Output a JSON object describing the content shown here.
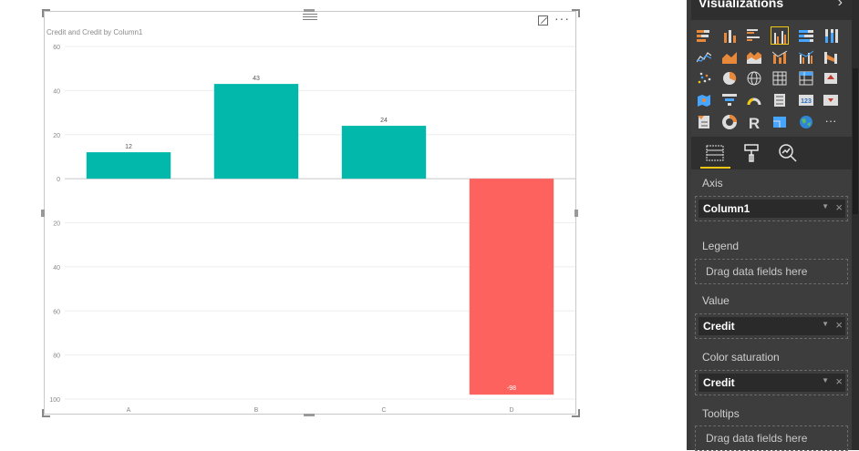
{
  "visual": {
    "title": "Credit and Credit by Column1",
    "more_glyph": "···"
  },
  "chart_data": {
    "type": "bar",
    "categories": [
      "A",
      "B",
      "C",
      "D"
    ],
    "values": [
      12,
      43,
      24,
      -98
    ],
    "data_labels": [
      "12",
      "43",
      "24",
      "-98"
    ],
    "title": "Credit and Credit by Column1",
    "ylim": [
      -100,
      60
    ],
    "y_ticks": [
      60,
      40,
      20,
      0,
      -20,
      -40,
      -60,
      -80,
      -100
    ],
    "y_tick_labels": [
      "60",
      "40",
      "20",
      "0",
      "20",
      "40",
      "60",
      "80",
      "100"
    ],
    "grid": true,
    "colors": {
      "positive": "#01b8aa",
      "negative": "#fd625e"
    }
  },
  "panel": {
    "title": "Visualizations",
    "chevron": "›",
    "icons": [
      "stacked-bar-icon",
      "stacked-column-icon",
      "clustered-bar-icon",
      "clustered-column-icon",
      "100-stacked-bar-icon",
      "100-stacked-column-icon",
      "line-chart-icon",
      "area-chart-icon",
      "stacked-area-icon",
      "line-column-icon",
      "line-clustered-column-icon",
      "ribbon-chart-icon",
      "scatter-icon",
      "pie-icon",
      "globe-map-icon",
      "table-icon",
      "matrix-icon",
      "filled-map-icon",
      "map-icon",
      "funnel-icon",
      "gauge-icon",
      "multi-row-card-icon",
      "card-icon",
      "kpi-icon",
      "slicer-icon",
      "donut-icon",
      "r-visual-icon",
      "shape-map-icon",
      "globe-icon",
      "more-visuals-icon"
    ],
    "r_glyph": "R",
    "card_glyph": "123",
    "more_glyph": "···",
    "sections": {
      "axis": {
        "label": "Axis",
        "field": "Column1"
      },
      "legend": {
        "label": "Legend",
        "placeholder": "Drag data fields here"
      },
      "value": {
        "label": "Value",
        "field": "Credit"
      },
      "color_saturation": {
        "label": "Color saturation",
        "field": "Credit"
      },
      "tooltips": {
        "label": "Tooltips",
        "placeholder": "Drag data fields here"
      }
    },
    "caret_glyph": "▼",
    "remove_glyph": "×"
  },
  "colors": {
    "panel_bg": "#3d3d3d",
    "accent": "#f2c811",
    "teal": "#01b8aa",
    "coral": "#fd625e"
  }
}
